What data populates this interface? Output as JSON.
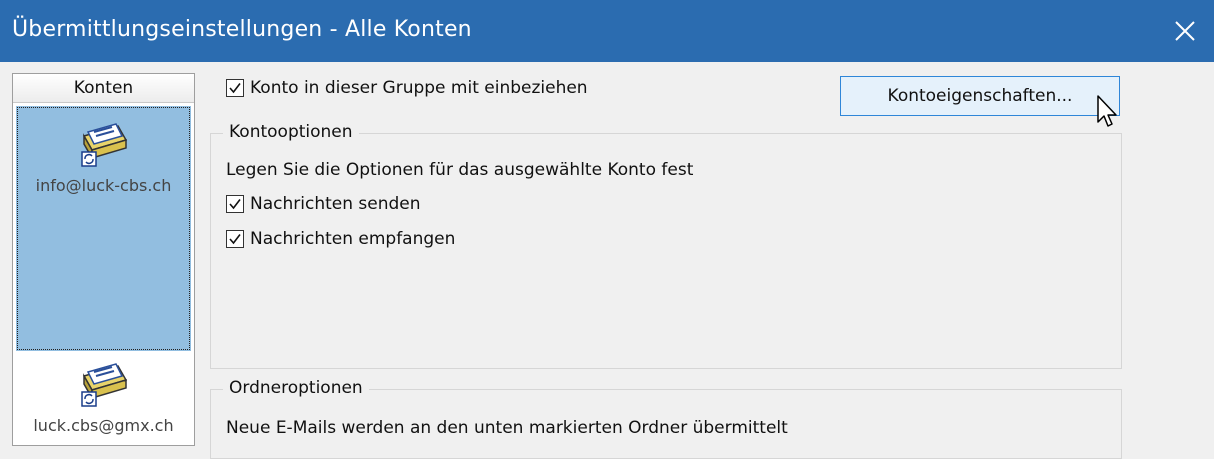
{
  "window": {
    "title": "Übermittlungseinstellungen - Alle Konten",
    "close_icon": "close-icon"
  },
  "accounts": {
    "header": "Konten",
    "items": [
      {
        "label": "info@luck-cbs.ch",
        "icon": "mail-account-icon",
        "selected": true
      },
      {
        "label": "luck.cbs@gmx.ch",
        "icon": "mail-account-icon",
        "selected": false
      }
    ]
  },
  "include_in_group": {
    "label": "Konto in dieser Gruppe mit einbeziehen",
    "checked": true
  },
  "properties_button": {
    "label": "Kontoeigenschaften..."
  },
  "account_options": {
    "legend": "Kontooptionen",
    "description": "Legen Sie die Optionen für das ausgewählte Konto fest",
    "send": {
      "label": "Nachrichten senden",
      "checked": true
    },
    "receive": {
      "label": "Nachrichten empfangen",
      "checked": true
    }
  },
  "folder_options": {
    "legend": "Ordneroptionen",
    "description": "Neue E-Mails werden an den unten markierten Ordner übermittelt"
  },
  "colors": {
    "titlebar": "#2b6cb0",
    "selection": "#92bee0",
    "button_border": "#2f86d8"
  }
}
